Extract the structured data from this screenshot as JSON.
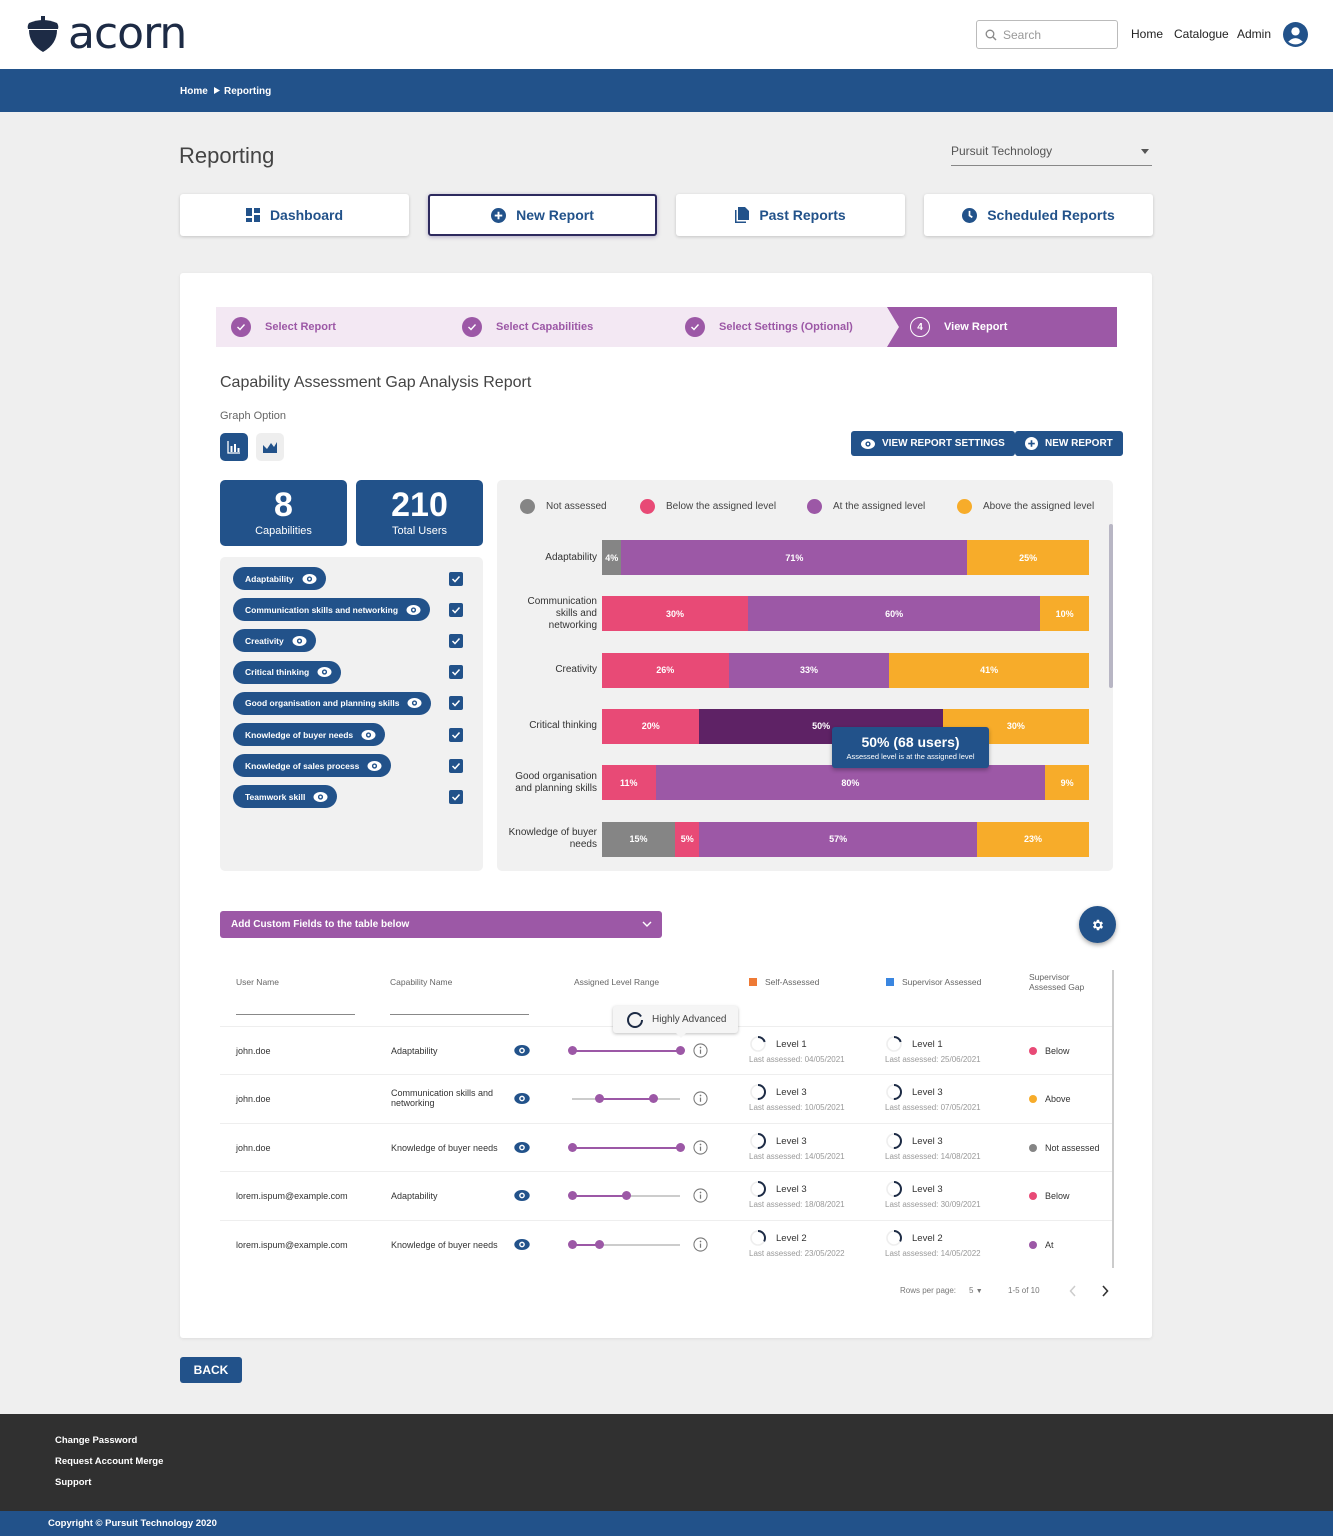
{
  "header": {
    "logo": "acorn",
    "search_placeholder": "Search",
    "nav": [
      "Home",
      "Catalogue",
      "Admin"
    ]
  },
  "breadcrumb": [
    "Home",
    "Reporting"
  ],
  "page": {
    "title": "Reporting",
    "org_select": "Pursuit Technology"
  },
  "tabs": [
    {
      "label": "Dashboard",
      "icon": "dashboard-icon"
    },
    {
      "label": "New Report",
      "icon": "plus-circle-icon",
      "active": true
    },
    {
      "label": "Past Reports",
      "icon": "document-icon"
    },
    {
      "label": "Scheduled Reports",
      "icon": "clock-icon"
    }
  ],
  "stepper": [
    {
      "label": "Select Report",
      "state": "done"
    },
    {
      "label": "Select Capabilities",
      "state": "done"
    },
    {
      "label": "Select Settings (Optional)",
      "state": "done"
    },
    {
      "label": "View Report",
      "state": "active",
      "number": "4"
    }
  ],
  "report": {
    "title": "Capability Assessment Gap Analysis Report",
    "graph_option_label": "Graph Option",
    "view_settings_btn": "VIEW REPORT SETTINGS",
    "new_report_btn": "NEW REPORT"
  },
  "stats": [
    {
      "value": "8",
      "label": "Capabilities"
    },
    {
      "value": "210",
      "label": "Total Users"
    }
  ],
  "capabilities": [
    {
      "name": "Adaptability",
      "checked": true
    },
    {
      "name": "Communication skills and networking",
      "checked": true
    },
    {
      "name": "Creativity",
      "checked": true
    },
    {
      "name": "Critical thinking",
      "checked": true
    },
    {
      "name": "Good organisation and planning skills",
      "checked": true
    },
    {
      "name": "Knowledge of buyer needs",
      "checked": true
    },
    {
      "name": "Knowledge of sales process",
      "checked": true
    },
    {
      "name": "Teamwork skill",
      "checked": true
    }
  ],
  "chart_data": {
    "type": "bar",
    "orientation": "horizontal",
    "stacked": true,
    "normalized_percent": true,
    "legend_position": "top",
    "colors": {
      "Not assessed": "#858585",
      "Below the assigned level": "#e84a76",
      "At the assigned level": "#9c58a6",
      "Above the assigned level": "#f7ac2a"
    },
    "highlight_color": "#5e2265",
    "categories": [
      "Adaptability",
      "Communication skills and networking",
      "Creativity",
      "Critical thinking",
      "Good organisation and planning skills",
      "Knowledge of buyer needs"
    ],
    "series": [
      {
        "name": "Not assessed",
        "values": [
          4,
          0,
          0,
          0,
          0,
          15
        ]
      },
      {
        "name": "Below the assigned level",
        "values": [
          0,
          30,
          26,
          20,
          11,
          5
        ]
      },
      {
        "name": "At the assigned level",
        "values": [
          71,
          60,
          33,
          50,
          80,
          57
        ]
      },
      {
        "name": "Above the assigned level",
        "values": [
          25,
          10,
          41,
          30,
          9,
          23
        ]
      }
    ],
    "tooltip": {
      "category": "Critical thinking",
      "series": "At the assigned level",
      "title": "50% (68 users)",
      "subtitle": "Assessed level is at the assigned level"
    }
  },
  "custom_fields": {
    "label": "Add Custom Fields to the table below"
  },
  "table": {
    "headers": {
      "user": "User Name",
      "capability": "Capability Name",
      "range": "Assigned Level Range",
      "self": "Self-Assessed",
      "supervisor": "Supervisor Assessed",
      "gap": "Supervisor Assessed Gap"
    },
    "header_colors": {
      "self": "#ee7a35",
      "supervisor": "#3a86e0"
    },
    "slider_tooltip": "Highly Advanced",
    "rows": [
      {
        "user": "john.doe",
        "capability": "Adaptability",
        "range": [
          0,
          1
        ],
        "self_level": "Level 1",
        "self_date": "Last assessed: 04/05/2021",
        "self_frac": 0.2,
        "sup_level": "Level 1",
        "sup_date": "Last assessed: 25/06/2021",
        "sup_frac": 0.2,
        "gap": "Below",
        "gap_color": "#e84a76"
      },
      {
        "user": "john.doe",
        "capability": "Communication skills and networking",
        "range": [
          0.25,
          0.75
        ],
        "self_level": "Level 3",
        "self_date": "Last assessed: 10/05/2021",
        "self_frac": 0.5,
        "sup_level": "Level 3",
        "sup_date": "Last assessed: 07/05/2021",
        "sup_frac": 0.5,
        "gap": "Above",
        "gap_color": "#f7ac2a"
      },
      {
        "user": "john.doe",
        "capability": "Knowledge of buyer needs",
        "range": [
          0,
          1
        ],
        "self_level": "Level 3",
        "self_date": "Last assessed: 14/05/2021",
        "self_frac": 0.5,
        "sup_level": "Level 3",
        "sup_date": "Last assessed: 14/08/2021",
        "sup_frac": 0.5,
        "gap": "Not assessed",
        "gap_color": "#858585"
      },
      {
        "user": "lorem.ispum@example.com",
        "capability": "Adaptability",
        "range": [
          0,
          0.5
        ],
        "self_level": "Level 3",
        "self_date": "Last assessed: 18/08/2021",
        "self_frac": 0.5,
        "sup_level": "Level 3",
        "sup_date": "Last assessed: 30/09/2021",
        "sup_frac": 0.5,
        "gap": "Below",
        "gap_color": "#e84a76"
      },
      {
        "user": "lorem.ispum@example.com",
        "capability": "Knowledge of buyer needs",
        "range": [
          0,
          0.25
        ],
        "self_level": "Level 2",
        "self_date": "Last assessed: 23/05/2022",
        "self_frac": 0.33,
        "sup_level": "Level 2",
        "sup_date": "Last assessed: 14/05/2022",
        "sup_frac": 0.33,
        "gap": "At",
        "gap_color": "#9c58a6"
      }
    ],
    "pagination": {
      "rows_per_page_label": "Rows per page:",
      "rows_per_page": "5",
      "range": "1-5 of 10"
    }
  },
  "back_label": "BACK",
  "footer": {
    "links": [
      "Change Password",
      "Request Account Merge",
      "Support"
    ],
    "copyright": "Copyright © Pursuit Technology 2020"
  }
}
